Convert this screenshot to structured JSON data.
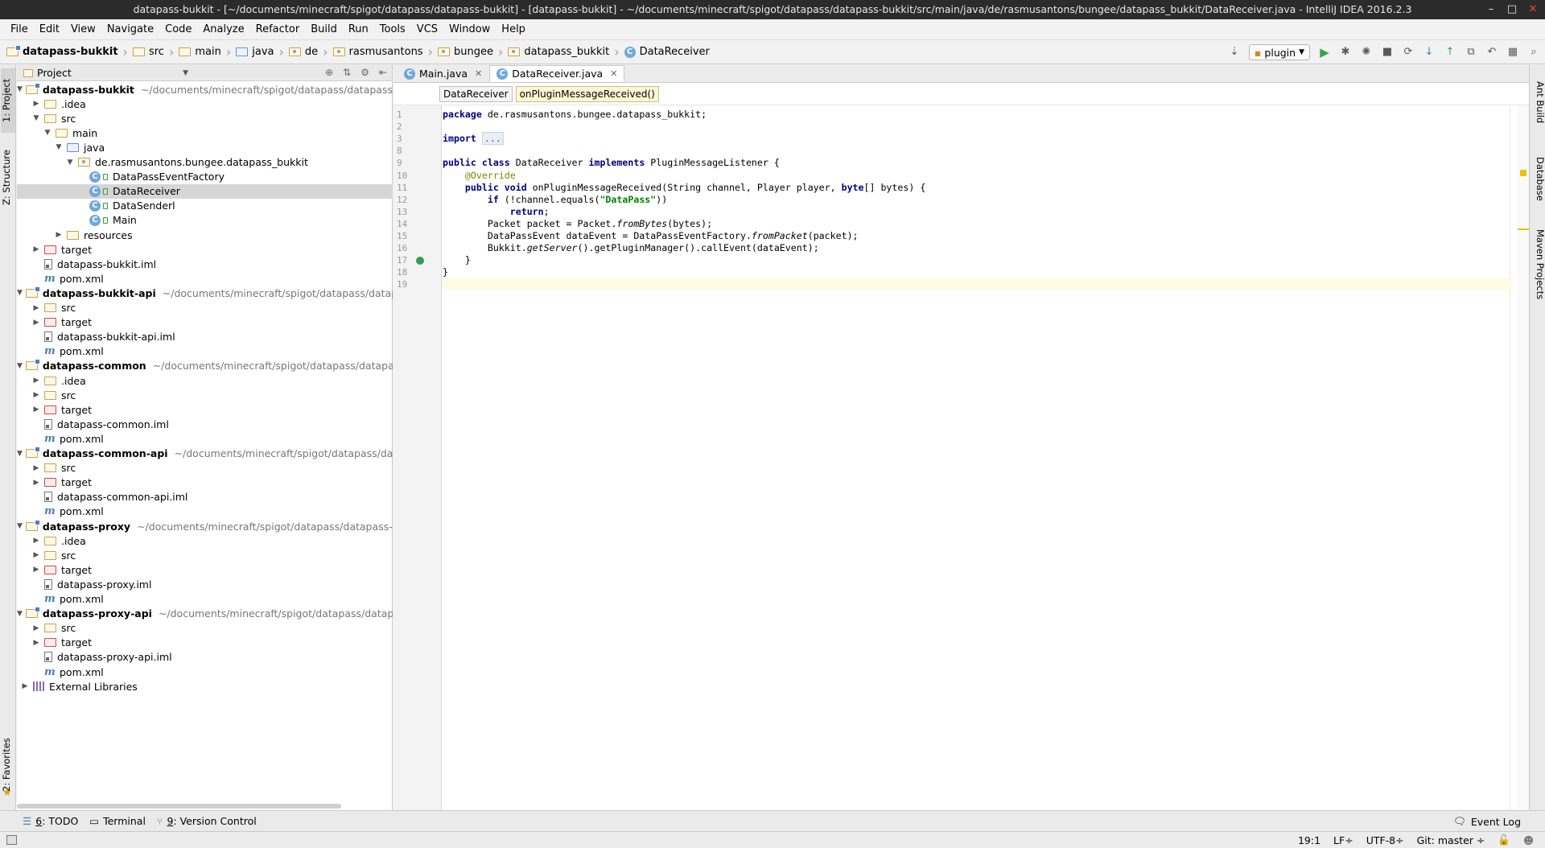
{
  "window": {
    "title": "datapass-bukkit - [~/documents/minecraft/spigot/datapass/datapass-bukkit] - [datapass-bukkit] - ~/documents/minecraft/spigot/datapass/datapass-bukkit/src/main/java/de/rasmusantons/bungee/datapass_bukkit/DataReceiver.java - IntelliJ IDEA 2016.2.3",
    "buttons": {
      "minimize": "–",
      "maximize": "□",
      "close": "✕"
    }
  },
  "menu": [
    "File",
    "Edit",
    "View",
    "Navigate",
    "Code",
    "Analyze",
    "Refactor",
    "Build",
    "Run",
    "Tools",
    "VCS",
    "Window",
    "Help"
  ],
  "breadcrumbs": [
    "datapass-bukkit",
    "src",
    "main",
    "java",
    "de",
    "rasmusantons",
    "bungee",
    "datapass_bukkit",
    "DataReceiver"
  ],
  "toolbar": {
    "run_config": "plugin"
  },
  "side_tabs": {
    "left": {
      "project": "1: Project",
      "structure": "Z: Structure",
      "favorites": "2: Favorites"
    },
    "right": {
      "ant": "Ant Build",
      "database": "Database",
      "maven": "Maven Projects"
    }
  },
  "project_panel": {
    "view": "Project",
    "tree": [
      {
        "depth": 0,
        "arrow": "open",
        "icon": "module-folder",
        "label": "datapass-bukkit",
        "bold": true,
        "path": "~/documents/minecraft/spigot/datapass/datapass-bukkit"
      },
      {
        "depth": 1,
        "arrow": "closed",
        "icon": "folder",
        "label": ".idea"
      },
      {
        "depth": 1,
        "arrow": "open",
        "icon": "folder",
        "label": "src"
      },
      {
        "depth": 2,
        "arrow": "open",
        "icon": "folder",
        "label": "main"
      },
      {
        "depth": 3,
        "arrow": "open",
        "icon": "source-folder",
        "label": "java"
      },
      {
        "depth": 4,
        "arrow": "open",
        "icon": "package",
        "label": "de.rasmusantons.bungee.datapass_bukkit"
      },
      {
        "depth": 5,
        "arrow": "none",
        "icon": "class",
        "label": "DataPassEventFactory"
      },
      {
        "depth": 5,
        "arrow": "none",
        "icon": "class",
        "label": "DataReceiver",
        "selected": true
      },
      {
        "depth": 5,
        "arrow": "none",
        "icon": "class",
        "label": "DataSenderl"
      },
      {
        "depth": 5,
        "arrow": "none",
        "icon": "class",
        "label": "Main"
      },
      {
        "depth": 3,
        "arrow": "closed",
        "icon": "folder",
        "label": "resources"
      },
      {
        "depth": 1,
        "arrow": "closed",
        "icon": "excluded-folder",
        "label": "target"
      },
      {
        "depth": 1,
        "arrow": "none",
        "icon": "iml",
        "label": "datapass-bukkit.iml"
      },
      {
        "depth": 1,
        "arrow": "none",
        "icon": "pom",
        "label": "pom.xml"
      },
      {
        "depth": 0,
        "arrow": "open",
        "icon": "module-folder",
        "label": "datapass-bukkit-api",
        "bold": true,
        "path": "~/documents/minecraft/spigot/datapass/datapass-bu"
      },
      {
        "depth": 1,
        "arrow": "closed",
        "icon": "folder",
        "label": "src"
      },
      {
        "depth": 1,
        "arrow": "closed",
        "icon": "excluded-folder",
        "label": "target"
      },
      {
        "depth": 1,
        "arrow": "none",
        "icon": "iml",
        "label": "datapass-bukkit-api.iml"
      },
      {
        "depth": 1,
        "arrow": "none",
        "icon": "pom",
        "label": "pom.xml"
      },
      {
        "depth": 0,
        "arrow": "open",
        "icon": "module-folder",
        "label": "datapass-common",
        "bold": true,
        "path": "~/documents/minecraft/spigot/datapass/datapass-com"
      },
      {
        "depth": 1,
        "arrow": "closed",
        "icon": "folder",
        "label": ".idea"
      },
      {
        "depth": 1,
        "arrow": "closed",
        "icon": "folder",
        "label": "src"
      },
      {
        "depth": 1,
        "arrow": "closed",
        "icon": "excluded-folder",
        "label": "target"
      },
      {
        "depth": 1,
        "arrow": "none",
        "icon": "iml",
        "label": "datapass-common.iml"
      },
      {
        "depth": 1,
        "arrow": "none",
        "icon": "pom",
        "label": "pom.xml"
      },
      {
        "depth": 0,
        "arrow": "open",
        "icon": "module-folder",
        "label": "datapass-common-api",
        "bold": true,
        "path": "~/documents/minecraft/spigot/datapass/datapass-"
      },
      {
        "depth": 1,
        "arrow": "closed",
        "icon": "folder",
        "label": "src"
      },
      {
        "depth": 1,
        "arrow": "closed",
        "icon": "excluded-folder",
        "label": "target"
      },
      {
        "depth": 1,
        "arrow": "none",
        "icon": "iml",
        "label": "datapass-common-api.iml"
      },
      {
        "depth": 1,
        "arrow": "none",
        "icon": "pom",
        "label": "pom.xml"
      },
      {
        "depth": 0,
        "arrow": "open",
        "icon": "module-folder",
        "label": "datapass-proxy",
        "bold": true,
        "path": "~/documents/minecraft/spigot/datapass/datapass-proxy"
      },
      {
        "depth": 1,
        "arrow": "closed",
        "icon": "folder",
        "label": ".idea"
      },
      {
        "depth": 1,
        "arrow": "closed",
        "icon": "folder",
        "label": "src"
      },
      {
        "depth": 1,
        "arrow": "closed",
        "icon": "excluded-folder",
        "label": "target"
      },
      {
        "depth": 1,
        "arrow": "none",
        "icon": "iml",
        "label": "datapass-proxy.iml"
      },
      {
        "depth": 1,
        "arrow": "none",
        "icon": "pom",
        "label": "pom.xml"
      },
      {
        "depth": 0,
        "arrow": "open",
        "icon": "module-folder",
        "label": "datapass-proxy-api",
        "bold": true,
        "path": "~/documents/minecraft/spigot/datapass/datapass-pro"
      },
      {
        "depth": 1,
        "arrow": "closed",
        "icon": "folder",
        "label": "src"
      },
      {
        "depth": 1,
        "arrow": "closed",
        "icon": "excluded-folder",
        "label": "target"
      },
      {
        "depth": 1,
        "arrow": "none",
        "icon": "iml",
        "label": "datapass-proxy-api.iml"
      },
      {
        "depth": 1,
        "arrow": "none",
        "icon": "pom",
        "label": "pom.xml"
      },
      {
        "depth": 0,
        "arrow": "closed",
        "icon": "libraries",
        "label": "External Libraries"
      }
    ]
  },
  "editor": {
    "tabs": [
      {
        "label": "Main.java",
        "active": false
      },
      {
        "label": "DataReceiver.java",
        "active": true
      }
    ],
    "structure_breadcrumb": [
      "DataReceiver",
      "onPluginMessageReceived()"
    ],
    "line_numbers": [
      "1",
      "2",
      "3",
      "8",
      "9",
      "10",
      "11",
      "12",
      "13",
      "14",
      "15",
      "16",
      "17",
      "18",
      "19"
    ],
    "current_line_index": 14,
    "code_lines": [
      [
        [
          "kw",
          "package"
        ],
        [
          "t",
          " de.rasmusantons.bungee.datapass_bukkit;"
        ]
      ],
      [],
      [
        [
          "kw",
          "import"
        ],
        [
          "t",
          " "
        ],
        [
          "fold",
          "..."
        ]
      ],
      [],
      [
        [
          "kw",
          "public class"
        ],
        [
          "t",
          " DataReceiver "
        ],
        [
          "kw",
          "implements"
        ],
        [
          "t",
          " PluginMessageListener {"
        ]
      ],
      [
        [
          "t",
          "    "
        ],
        [
          "ann",
          "@Override"
        ]
      ],
      [
        [
          "t",
          "    "
        ],
        [
          "kw",
          "public void"
        ],
        [
          "t",
          " onPluginMessageReceived(String channel, Player player, "
        ],
        [
          "kw",
          "byte"
        ],
        [
          "t",
          "[] bytes) {"
        ]
      ],
      [
        [
          "t",
          "        "
        ],
        [
          "kw",
          "if"
        ],
        [
          "t",
          " (!channel.equals("
        ],
        [
          "str",
          "\"DataPass\""
        ],
        [
          "t",
          "))"
        ]
      ],
      [
        [
          "t",
          "            "
        ],
        [
          "kw",
          "return"
        ],
        [
          "t",
          ";"
        ]
      ],
      [
        [
          "t",
          "        Packet packet = Packet."
        ],
        [
          "it",
          "fromBytes"
        ],
        [
          "t",
          "(bytes);"
        ]
      ],
      [
        [
          "t",
          "        DataPassEvent dataEvent = DataPassEventFactory."
        ],
        [
          "it",
          "fromPacket"
        ],
        [
          "t",
          "(packet);"
        ]
      ],
      [
        [
          "t",
          "        Bukkit."
        ],
        [
          "it",
          "getServer"
        ],
        [
          "t",
          "().getPluginManager().callEvent(dataEvent);"
        ]
      ],
      [
        [
          "t",
          "    }"
        ]
      ],
      [
        [
          "t",
          "}"
        ]
      ],
      []
    ]
  },
  "bottom_tools": [
    {
      "num": "6",
      "rest": ": TODO"
    },
    {
      "num": "",
      "rest": "Terminal"
    },
    {
      "num": "9",
      "rest": ": Version Control"
    }
  ],
  "event_log": "Event Log",
  "status": {
    "position": "19:1",
    "line_sep": "LF÷",
    "encoding": "UTF-8÷",
    "git": "Git: master ÷"
  }
}
